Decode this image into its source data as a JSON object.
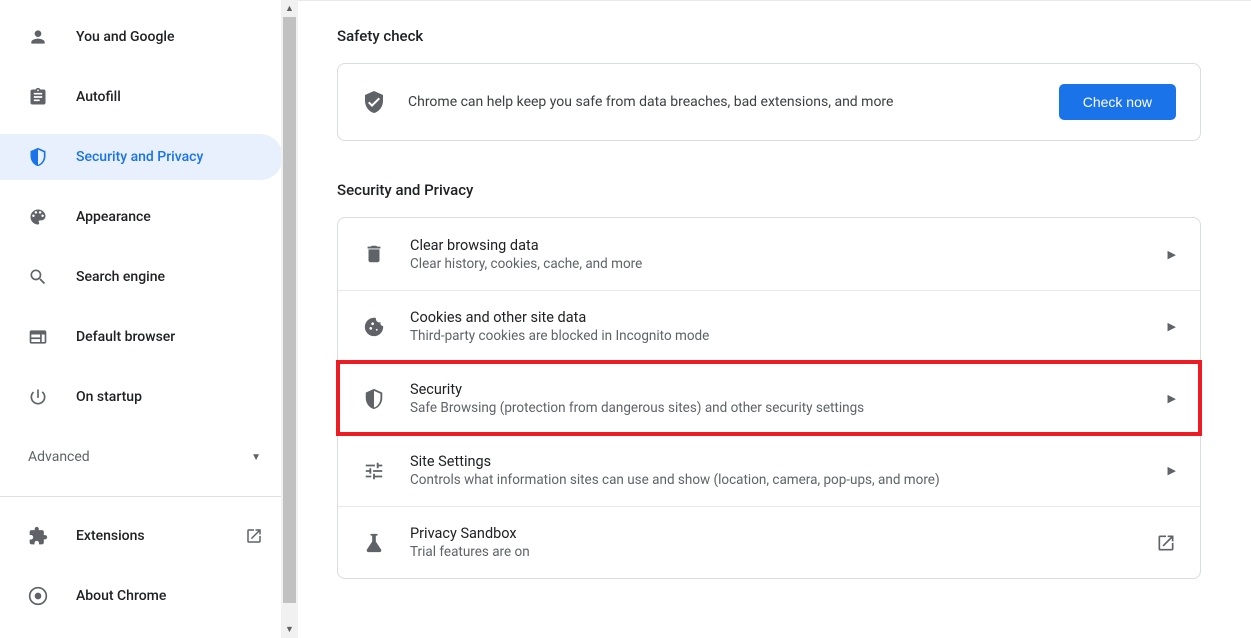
{
  "sidebar": {
    "items": [
      {
        "label": "You and Google"
      },
      {
        "label": "Autofill"
      },
      {
        "label": "Security and Privacy"
      },
      {
        "label": "Appearance"
      },
      {
        "label": "Search engine"
      },
      {
        "label": "Default browser"
      },
      {
        "label": "On startup"
      }
    ],
    "advanced_label": "Advanced",
    "bottom": [
      {
        "label": "Extensions"
      },
      {
        "label": "About Chrome"
      }
    ]
  },
  "main": {
    "safety_title": "Safety check",
    "safety_text": "Chrome can help keep you safe from data breaches, bad extensions, and more",
    "check_now_label": "Check now",
    "privacy_title": "Security and Privacy",
    "rows": [
      {
        "title": "Clear browsing data",
        "sub": "Clear history, cookies, cache, and more"
      },
      {
        "title": "Cookies and other site data",
        "sub": "Third-party cookies are blocked in Incognito mode"
      },
      {
        "title": "Security",
        "sub": "Safe Browsing (protection from dangerous sites) and other security settings"
      },
      {
        "title": "Site Settings",
        "sub": "Controls what information sites can use and show (location, camera, pop-ups, and more)"
      },
      {
        "title": "Privacy Sandbox",
        "sub": "Trial features are on"
      }
    ]
  }
}
